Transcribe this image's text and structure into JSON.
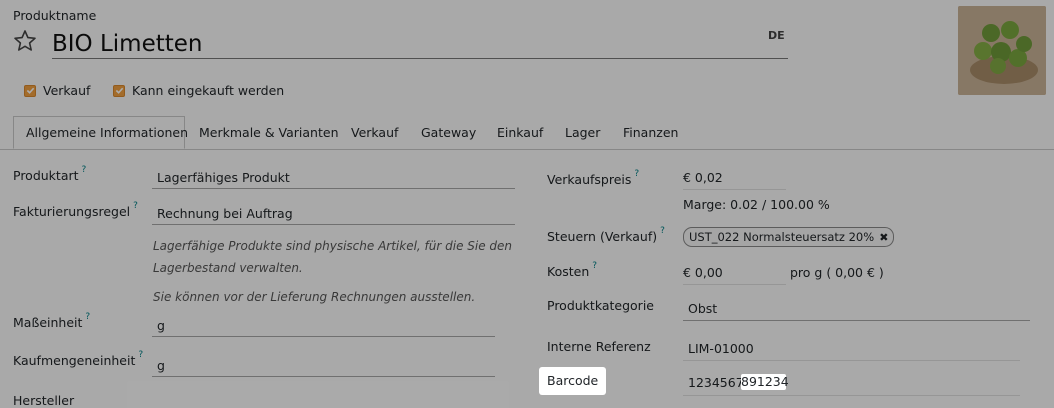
{
  "header": {
    "product_name_label": "Produktname",
    "product_name": "BIO Limetten",
    "lang": "DE"
  },
  "checkboxes": [
    {
      "label": "Verkauf",
      "checked": true
    },
    {
      "label": "Kann eingekauft werden",
      "checked": true
    }
  ],
  "tabs": [
    "Allgemeine Informationen",
    "Merkmale & Varianten",
    "Verkauf",
    "Gateway",
    "Einkauf",
    "Lager",
    "Finanzen"
  ],
  "left": {
    "produktart_label": "Produktart",
    "produktart_value": "Lagerfähiges Produkt",
    "fakturierung_label": "Fakturierungsregel",
    "fakturierung_value": "Rechnung bei Auftrag",
    "hint1": "Lagerfähige Produkte sind physische Artikel, für die Sie den Lagerbestand verwalten.",
    "hint2": "Sie können vor der Lieferung Rechnungen ausstellen.",
    "masseinheit_label": "Maßeinheit",
    "masseinheit_value": "g",
    "kaufmengeneinheit_label": "Kaufmengeneinheit",
    "kaufmengeneinheit_value": "g",
    "hersteller_label": "Hersteller"
  },
  "right": {
    "verkaufspreis_label": "Verkaufspreis",
    "verkaufspreis_value": "€ 0,02",
    "marge": "Marge: 0.02 / 100.00 %",
    "steuern_label": "Steuern (Verkauf)",
    "steuern_tag": "UST_022 Normalsteuersatz 20%",
    "kosten_label": "Kosten",
    "kosten_value": "€ 0,00",
    "kosten_unit": "pro g ( 0,00 € )",
    "kategorie_label": "Produktkategorie",
    "kategorie_value": "Obst",
    "referenz_label": "Interne Referenz",
    "referenz_value": "LIM-01000",
    "barcode_label": "Barcode",
    "barcode_value_a": "1234567",
    "barcode_value_b": "891234"
  },
  "colors": {
    "accent": "#017e84",
    "checkbox": "#f0a040"
  }
}
